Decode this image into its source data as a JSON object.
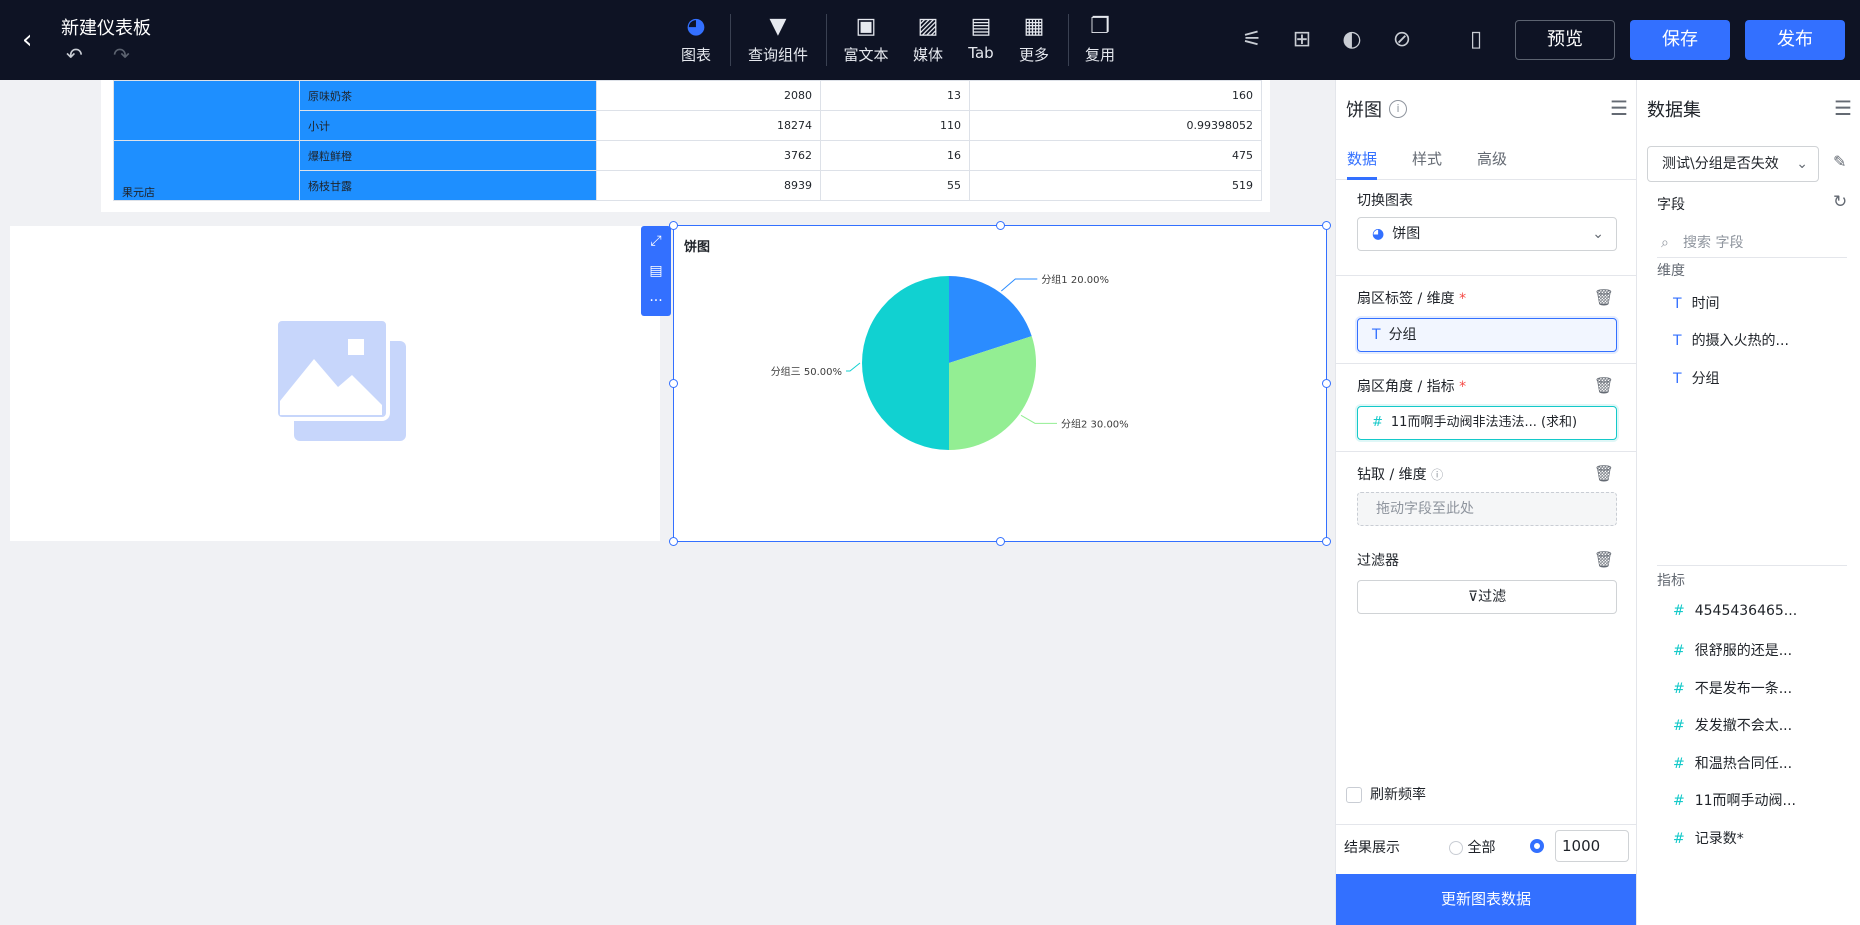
{
  "header": {
    "title": "新建仪表板",
    "tools": [
      {
        "label": "图表",
        "icon": "pie-chart-icon"
      },
      {
        "label": "查询组件",
        "icon": "filter-icon"
      },
      {
        "label": "富文本",
        "icon": "text-icon"
      },
      {
        "label": "媒体",
        "icon": "image-icon"
      },
      {
        "label": "Tab",
        "icon": "tab-icon"
      },
      {
        "label": "更多",
        "icon": "grid-icon"
      },
      {
        "label": "复用",
        "icon": "copy-icon"
      }
    ],
    "preview": "预览",
    "save": "保存",
    "publish": "发布"
  },
  "table": {
    "rows": [
      {
        "dim1": "",
        "dim2": "原味奶茶",
        "v1": "2080",
        "v2": "13",
        "v3": "160"
      },
      {
        "dim1": "",
        "dim2": "小计",
        "v1": "18274",
        "v2": "110",
        "v3": "0.99398052"
      },
      {
        "dim1": "",
        "dim2": "爆粒鲜橙",
        "v1": "3762",
        "v2": "16",
        "v3": "475"
      },
      {
        "dim1": "果元店",
        "dim2": "杨枝甘露",
        "v1": "8939",
        "v2": "55",
        "v3": "519"
      }
    ]
  },
  "pie": {
    "title": "饼图",
    "slices": [
      {
        "label": "分组1 20.00%",
        "value": 20,
        "color": "#2b8cff"
      },
      {
        "label": "分组2 30.00%",
        "value": 30,
        "color": "#93ee93"
      },
      {
        "label": "分组三 50.00%",
        "value": 50,
        "color": "#11d1d1"
      }
    ]
  },
  "props": {
    "title": "饼图",
    "tabs": [
      "数据",
      "样式",
      "高级"
    ],
    "switch_chart_label": "切换图表",
    "chart_type": "饼图",
    "sector_label_title": "扇区标签 / 维度",
    "sector_label_field": "分组",
    "sector_angle_title": "扇区角度 / 指标",
    "sector_angle_field": "11而啊手动阀非法违法...  (求和)",
    "drill_title": "钻取 / 维度",
    "drill_placeholder": "拖动字段至此处",
    "filter_title": "过滤器",
    "filter_button": "过滤",
    "refresh_label": "刷新频率",
    "result_label": "结果展示",
    "result_all": "全部",
    "result_count": "1000",
    "update_button": "更新图表数据"
  },
  "dataset": {
    "title": "数据集",
    "selected": "测试\\分组是否失效",
    "fields_label": "字段",
    "search_placeholder": "搜索 字段",
    "dimension_label": "维度",
    "dimensions": [
      "时间",
      "的摄入火热的...",
      "分组"
    ],
    "metric_label": "指标",
    "metrics": [
      "4545436465...",
      "很舒服的还是...",
      "不是发布一条...",
      "发发撤不会太...",
      "和温热合同任...",
      "11而啊手动阀...",
      "记录数*"
    ]
  }
}
